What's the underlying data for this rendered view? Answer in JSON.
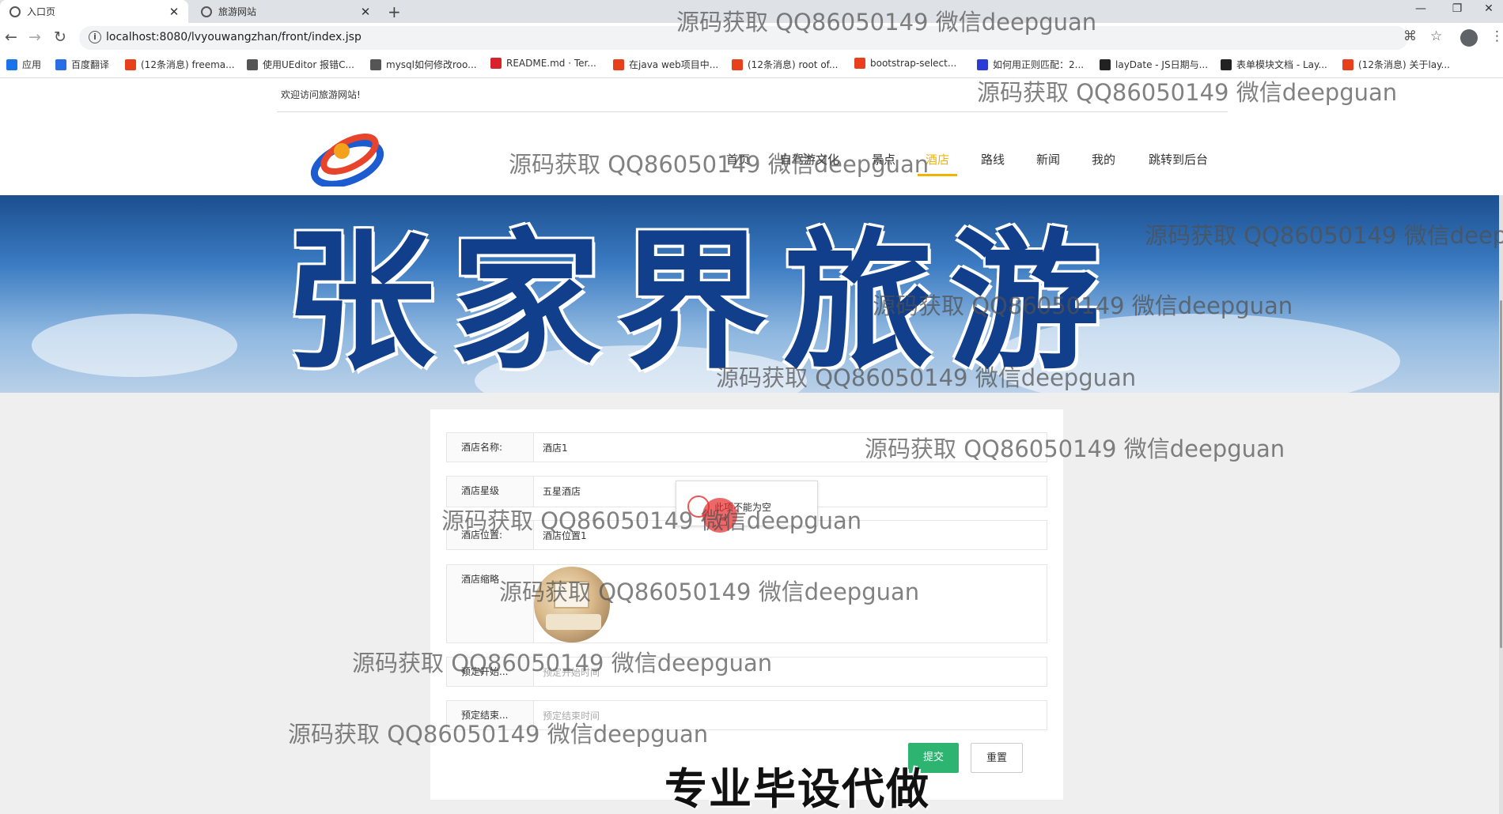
{
  "browser": {
    "tabs": [
      {
        "title": "入口页",
        "active": true
      },
      {
        "title": "旅游网站",
        "active": false
      }
    ],
    "url": "localhost:8080/lvyouwangzhan/front/index.jsp",
    "bookmarks": [
      {
        "label": "应用",
        "color": "#1a73e8"
      },
      {
        "label": "百度翻译",
        "color": "#2b6de5"
      },
      {
        "label": "(12条消息) freema...",
        "color": "#e8401c"
      },
      {
        "label": "使用UEditor 报错C...",
        "color": "#555555"
      },
      {
        "label": "mysql如何修改roo...",
        "color": "#555555"
      },
      {
        "label": "README.md · Ter...",
        "color": "#d6232c"
      },
      {
        "label": "在java web项目中...",
        "color": "#e8401c"
      },
      {
        "label": "(12条消息) root of...",
        "color": "#e8401c"
      },
      {
        "label": "bootstrap-select...",
        "color": "#e8401c"
      },
      {
        "label": "如何用正则匹配：2...",
        "color": "#2b3bd6"
      },
      {
        "label": "layDate - JS日期与...",
        "color": "#222222"
      },
      {
        "label": "表单模块文档 - Lay...",
        "color": "#222222"
      },
      {
        "label": "(12条消息) 关于lay...",
        "color": "#e8401c"
      }
    ]
  },
  "site": {
    "welcome": "欢迎访问旅游网站!",
    "nav": [
      {
        "label": "首页",
        "active": false
      },
      {
        "label": "自驾游文化",
        "active": false
      },
      {
        "label": "景点",
        "active": false
      },
      {
        "label": "酒店",
        "active": true
      },
      {
        "label": "路线",
        "active": false
      },
      {
        "label": "新闻",
        "active": false
      },
      {
        "label": "我的",
        "active": false
      },
      {
        "label": "跳转到后台",
        "active": false
      }
    ],
    "banner_title": "张家界旅游",
    "accent_color": "#f0b400"
  },
  "form": {
    "rows": [
      {
        "label": "酒店名称:",
        "value": "酒店1",
        "placeholder": ""
      },
      {
        "label": "酒店星级",
        "value": "五星酒店",
        "placeholder": ""
      },
      {
        "label": "酒店位置:",
        "value": "酒店位置1",
        "placeholder": ""
      },
      {
        "label": "酒店缩略",
        "value": "",
        "placeholder": ""
      },
      {
        "label": "预定开始...",
        "value": "",
        "placeholder": "预定开始时间"
      },
      {
        "label": "预定结束...",
        "value": "",
        "placeholder": "预定结束时间"
      }
    ],
    "tooltip": "此项不能为空",
    "submit_label": "提交",
    "reset_label": "重置",
    "submit_color": "#2db470"
  },
  "overlay": {
    "watermark": "源码获取 QQ86050149 微信deepguan",
    "ad_text": "专业毕设代做"
  }
}
